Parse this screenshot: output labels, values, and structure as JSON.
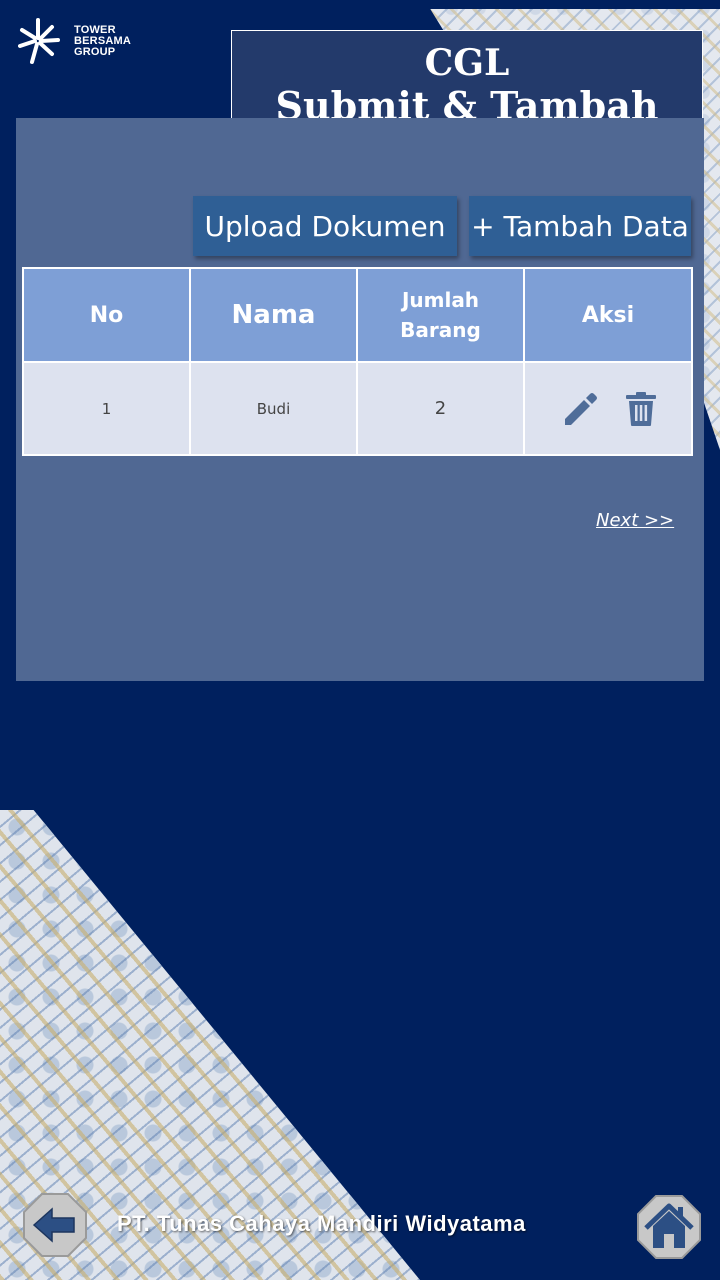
{
  "brand": {
    "logo_lines": [
      "TOWER",
      "BERSAMA",
      "GROUP"
    ],
    "colors": {
      "background": "#00205e",
      "panel": "#506893",
      "header": "#7e9fd6",
      "button": "#2f5f95"
    }
  },
  "title": {
    "line1": "CGL",
    "line2": "Submit & Tambah Data"
  },
  "toolbar": {
    "upload_label": "Upload Dokumen",
    "add_label": "+ Tambah Data"
  },
  "table": {
    "headers": {
      "no": "No",
      "nama": "Nama",
      "jumlah_line1": "Jumlah",
      "jumlah_line2": "Barang",
      "aksi": "Aksi"
    },
    "rows": [
      {
        "no": "1",
        "nama": "Budi",
        "jumlah": "2",
        "actions": [
          "pencil-icon",
          "trash-icon"
        ]
      }
    ]
  },
  "pagination": {
    "next_label": "Next >>"
  },
  "footer": {
    "company": "PT. Tunas Cahaya Mandiri Widyatama",
    "back_icon": "arrow-left-icon",
    "home_icon": "home-icon"
  }
}
